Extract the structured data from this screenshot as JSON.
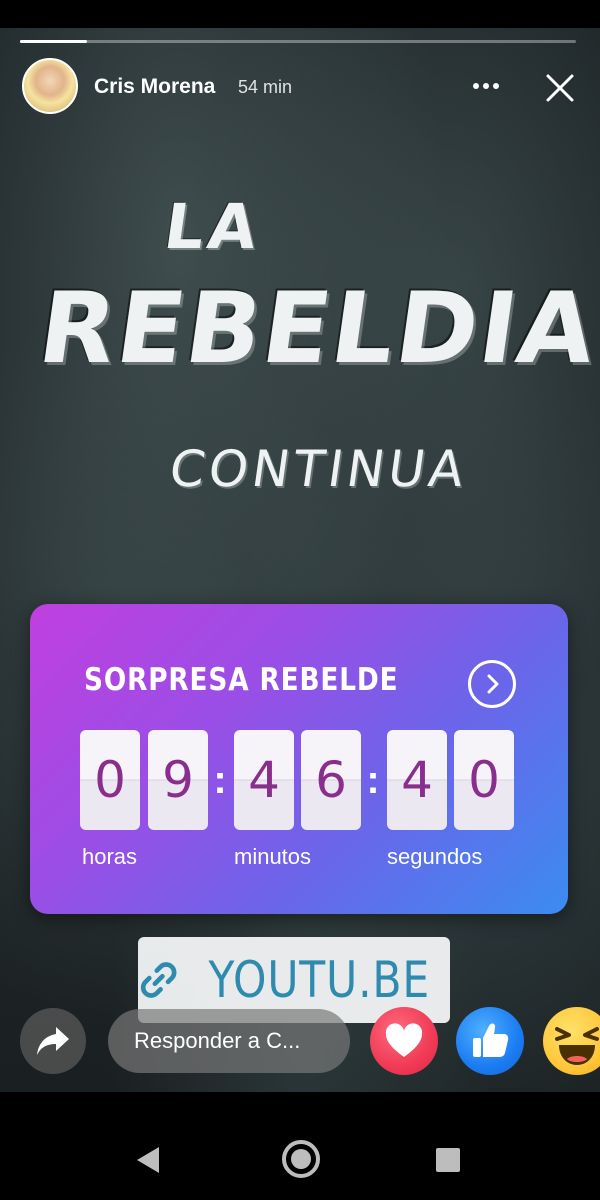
{
  "story": {
    "progress_fraction": 0.12,
    "user": {
      "name": "Cris Morena",
      "time_ago": "54 min"
    },
    "title": {
      "line1": "LA",
      "line2": "REBELDIA",
      "line3": "CONTINUA"
    }
  },
  "countdown": {
    "title": "SORPRESA REBELDE",
    "digits": [
      "0",
      "9",
      "4",
      "6",
      "4",
      "0"
    ],
    "labels": {
      "hours": "horas",
      "minutes": "minutos",
      "seconds": "segundos"
    }
  },
  "link_sticker": {
    "text": "YOUTU.BE",
    "icon": "link-icon"
  },
  "footer": {
    "reply_placeholder": "Responder a C...",
    "reactions": [
      "love-icon",
      "like-icon",
      "haha-icon"
    ],
    "colors": {
      "love": "#f03a56",
      "like": "#1b7cf2",
      "haha": "#ffc73a"
    }
  },
  "icons": {
    "more": "more-options-icon",
    "close": "close-icon",
    "share": "share-icon",
    "nav": [
      "back-icon",
      "home-icon",
      "recents-icon"
    ]
  }
}
